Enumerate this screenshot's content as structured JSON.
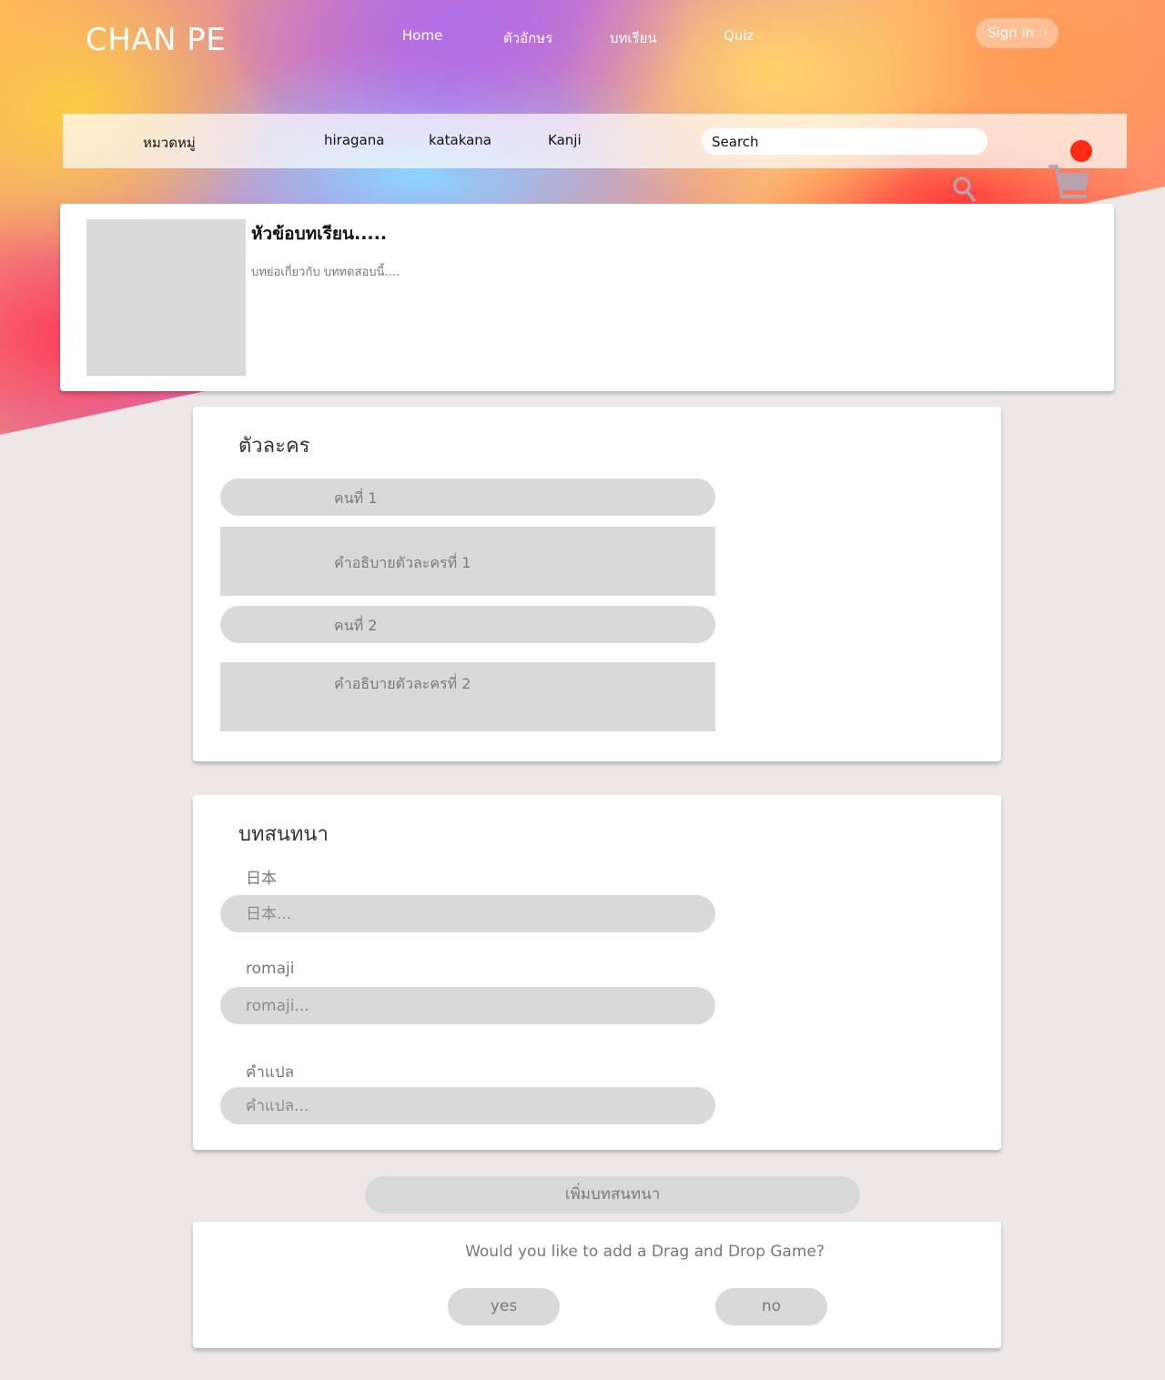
{
  "header": {
    "logo": "CHAN PE",
    "nav": [
      "Home",
      "ตัวอักษร",
      "บทเรียน",
      "Quiz"
    ],
    "sign_in": "Sign in"
  },
  "category_bar": {
    "items": [
      "หมวดหมู่",
      "hiragana",
      "katakana",
      "Kanji"
    ],
    "search_placeholder": "Search"
  },
  "colors": {
    "accent_dot": "#ff2a12",
    "cart": "#b9a2b0",
    "placeholder_fill": "#d9d9d9"
  },
  "icons": [
    "search-icon",
    "cart-icon"
  ],
  "lesson": {
    "title": "หัวข้อบทเรียน.....",
    "description": "บทย่อเกี่ยวกับ บททดสอบนี้...."
  },
  "characters": {
    "title": "ตัวละคร",
    "items": [
      {
        "name": "คนที่ 1",
        "description": "คำอธิบายตัวละครที่ 1"
      },
      {
        "name": "คนที่ 2",
        "description": "คำอธิบายตัวละครที่ 2"
      }
    ]
  },
  "conversation": {
    "title": "บทสนทนา",
    "fields": [
      {
        "label": "日本",
        "placeholder": "日本..."
      },
      {
        "label": "romaji",
        "placeholder": "romaji..."
      },
      {
        "label": "คำแปล",
        "placeholder": "คำแปล..."
      }
    ]
  },
  "add_conversation": "เพิ่มบทสนทนา",
  "game_prompt": {
    "question": "Would you like to add a Drag and Drop Game?",
    "yes": "yes",
    "no": "no"
  }
}
